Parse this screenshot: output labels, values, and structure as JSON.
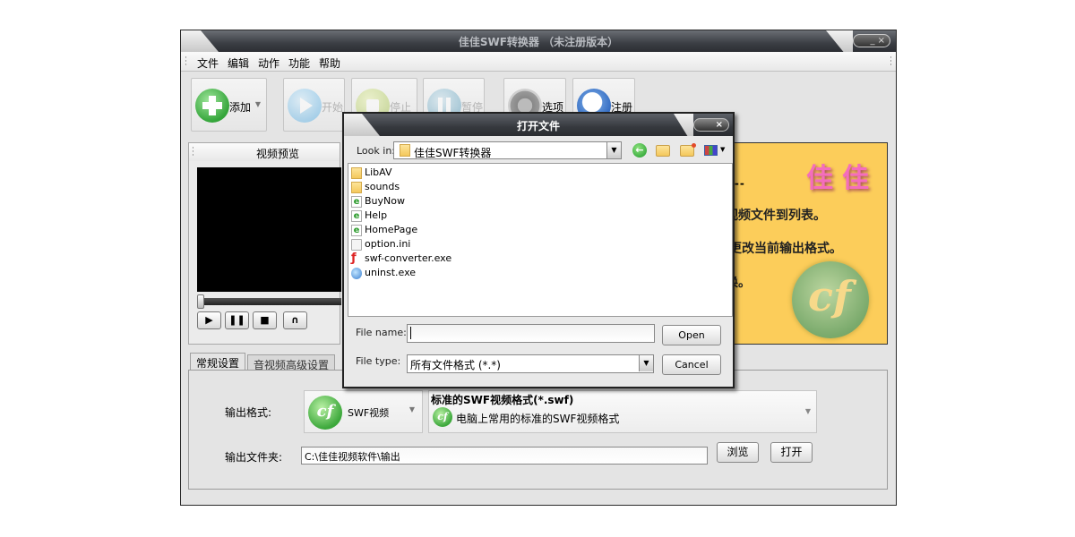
{
  "app": {
    "title": "佳佳SWF转换器 （未注册版本）",
    "window_controls": "_ ×"
  },
  "menu": [
    "文件",
    "编辑",
    "动作",
    "功能",
    "帮助"
  ],
  "toolbar": {
    "add": "添加",
    "start": "开始",
    "stop": "停止",
    "pause": "暂停",
    "options": "选项",
    "register": "注册"
  },
  "preview": {
    "title": "视频预览",
    "controls": {
      "play": "▶",
      "pause": "❚❚",
      "stop": "■",
      "loop": "∩"
    }
  },
  "banner": {
    "logo": "佳佳",
    "dashes": "------",
    "line1": "视频文件到列表。",
    "line2": "中更改当前输出格式。",
    "line3": "换。",
    "flash_glyph": "cf"
  },
  "tabs": [
    "常规设置",
    "音视频高级设置"
  ],
  "settings": {
    "output_format_label": "输出格式:",
    "format_name": "SWF视频",
    "format_title": "标准的SWF视频格式(*.swf)",
    "format_desc": "电脑上常用的标准的SWF视频格式",
    "output_folder_label": "输出文件夹:",
    "output_folder": "C:\\佳佳视频软件\\输出",
    "browse": "浏览",
    "open": "打开"
  },
  "dialog": {
    "title": "打开文件",
    "close": "×",
    "look_in_label": "Look in:",
    "look_in_value": "佳佳SWF转换器",
    "files": [
      {
        "name": "LibAV",
        "type": "folder"
      },
      {
        "name": "sounds",
        "type": "folder"
      },
      {
        "name": "BuyNow",
        "type": "html"
      },
      {
        "name": "Help",
        "type": "html"
      },
      {
        "name": "HomePage",
        "type": "html"
      },
      {
        "name": "option.ini",
        "type": "ini"
      },
      {
        "name": "swf-converter.exe",
        "type": "flash"
      },
      {
        "name": "uninst.exe",
        "type": "exe"
      }
    ],
    "file_name_label": "File name:",
    "file_name_value": "",
    "file_type_label": "File type:",
    "file_type_value": "所有文件格式 (*.*)",
    "open_button": "Open",
    "cancel_button": "Cancel"
  }
}
